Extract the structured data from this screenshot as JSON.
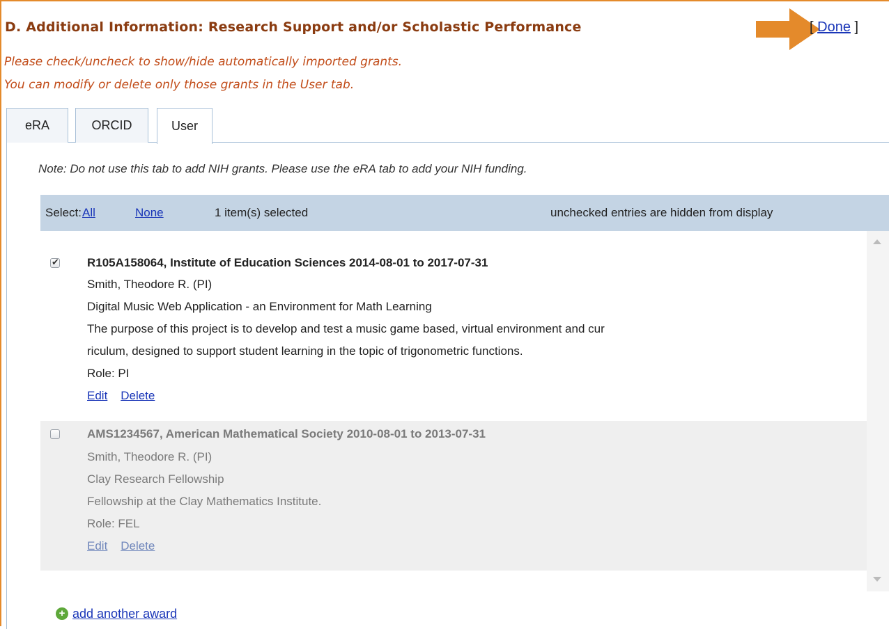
{
  "section": {
    "title": "D. Additional Information: Research Support and/or Scholastic Performance",
    "done_open": "[",
    "done_label": "Done",
    "done_close": "]",
    "instruction_1": "Please check/uncheck to show/hide automatically imported grants.",
    "instruction_2": "You can modify or delete only those grants in the User tab."
  },
  "tabs": [
    {
      "label": "eRA",
      "active": false
    },
    {
      "label": "ORCID",
      "active": false
    },
    {
      "label": "User",
      "active": true
    }
  ],
  "note": "Note: Do not use this tab to add NIH grants. Please use the eRA tab to add your NIH funding.",
  "select_bar": {
    "label": "Select:",
    "all": "All",
    "none": "None",
    "count": "1 item(s) selected",
    "hint": "unchecked entries are hidden from display"
  },
  "grants": [
    {
      "checked": true,
      "header": "R105A158064, Institute of Education Sciences 2014-08-01 to 2017-07-31",
      "investigator": "Smith, Theodore R. (PI)",
      "project_title": "Digital Music Web Application - an Environment for Math Learning",
      "description_1": "The purpose of this project is to develop and test a music game based, virtual environment and cur",
      "description_2": "riculum, designed to support student learning in the topic of trigonometric functions.",
      "role": "Role: PI",
      "edit": "Edit",
      "delete": "Delete"
    },
    {
      "checked": false,
      "header": "AMS1234567, American Mathematical Society 2010-08-01 to 2013-07-31",
      "investigator": "Smith, Theodore R. (PI)",
      "project_title": "Clay Research Fellowship",
      "description_1": "Fellowship at the Clay Mathematics Institute.",
      "role": "Role: FEL",
      "edit": "Edit",
      "delete": "Delete"
    }
  ],
  "add_award": "add another award",
  "colors": {
    "accent_orange": "#e48a2b",
    "title_brown": "#8a3b10",
    "instruction_red": "#c24d1a",
    "link_blue": "#1a36b8",
    "select_bar_bg": "#c4d4e4"
  },
  "icons": {
    "annotation": "orange-arrow-icon",
    "add": "plus-circle-icon",
    "checked": "checkmark-icon"
  }
}
